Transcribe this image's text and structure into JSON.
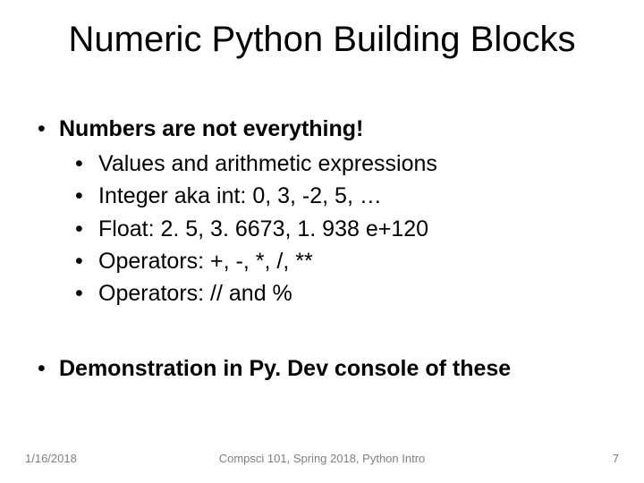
{
  "title": "Numeric Python Building Blocks",
  "bullets": {
    "top1": "Numbers are not everything!",
    "sub": [
      "Values and arithmetic expressions",
      "Integer aka int: 0, 3, -2, 5, …",
      "Float: 2. 5, 3. 6673, 1. 938 e+120",
      "Operators: +, -, *, /, **",
      "Operators: // and %"
    ],
    "top2": "Demonstration in Py. Dev console of these"
  },
  "footer": {
    "date": "1/16/2018",
    "center": "Compsci 101, Spring 2018, Python Intro",
    "page": "7"
  }
}
